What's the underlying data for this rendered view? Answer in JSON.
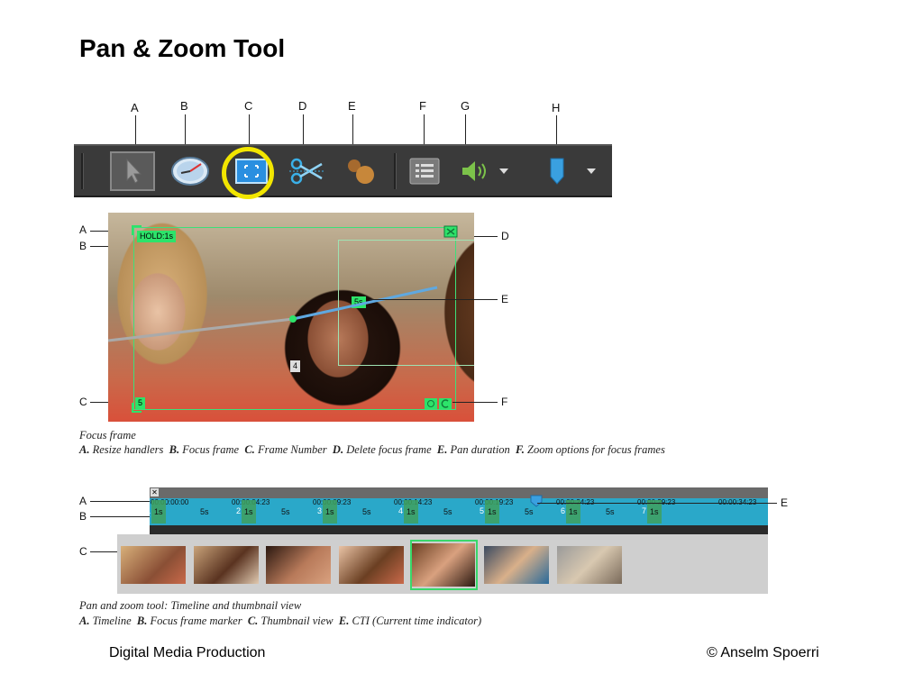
{
  "title": "Pan & Zoom Tool",
  "toolbar": {
    "callouts": [
      "A",
      "B",
      "C",
      "D",
      "E",
      "F",
      "G",
      "H"
    ],
    "buttons": [
      {
        "name": "selection-tool",
        "icon": "cursor-arrow-icon",
        "color": "#9a9a9a"
      },
      {
        "name": "time-stretch-tool",
        "icon": "clock-icon",
        "color": "#cfe3f3"
      },
      {
        "name": "pan-zoom-tool",
        "icon": "pan-zoom-frame-icon",
        "color": "#2a8fe0"
      },
      {
        "name": "scissors-tool",
        "icon": "scissors-icon",
        "color": "#3ab0e8"
      },
      {
        "name": "smart-trim-tool",
        "icon": "balloon-icon",
        "color": "#c7873a"
      },
      {
        "name": "properties-tool",
        "icon": "list-icon",
        "color": "#9a9a9a"
      },
      {
        "name": "audio-tool",
        "icon": "speaker-icon",
        "color": "#7cc24a"
      },
      {
        "name": "marker-tool",
        "icon": "marker-icon",
        "color": "#3aa0e0"
      }
    ],
    "highlight_color": "#f2e600"
  },
  "focus_frame": {
    "callouts_left": [
      "A",
      "B",
      "C"
    ],
    "callouts_right": [
      "D",
      "E",
      "F"
    ],
    "hold_tag": "HOLD:1s",
    "pan_duration_tag": "5s",
    "frame_number": "5",
    "secondary_frame_number": "4",
    "frame_color": "#3de07a",
    "caption_title": "Focus frame",
    "caption_items": [
      {
        "key": "A.",
        "text": "Resize handlers"
      },
      {
        "key": "B.",
        "text": "Focus frame"
      },
      {
        "key": "C.",
        "text": "Frame Number"
      },
      {
        "key": "D.",
        "text": "Delete focus frame"
      },
      {
        "key": "E.",
        "text": "Pan duration"
      },
      {
        "key": "F.",
        "text": "Zoom options for focus frames"
      }
    ]
  },
  "timeline": {
    "callouts_left": [
      "A",
      "B",
      "C"
    ],
    "callout_right": "E",
    "timecodes": [
      "00:00:00:00",
      "00:00:04:23",
      "00:00:09:23",
      "00:00:14:23",
      "00:00:19:23",
      "00:00:24:23",
      "00:00:29:23",
      "00:00:34:23"
    ],
    "frame_numbers": [
      "1",
      "2",
      "3",
      "4",
      "5",
      "6",
      "7"
    ],
    "hold_labels": [
      "1s",
      "1s",
      "1s",
      "1s",
      "1s",
      "1s",
      "1s"
    ],
    "pan_labels": [
      "5s",
      "5s",
      "5s",
      "5s",
      "5s",
      "5s"
    ],
    "ruler_color": "#2aa8c9",
    "caption_title": "Pan and zoom tool: Timeline and thumbnail view",
    "caption_items": [
      {
        "key": "A.",
        "text": "Timeline"
      },
      {
        "key": "B.",
        "text": "Focus frame marker"
      },
      {
        "key": "C.",
        "text": "Thumbnail view"
      },
      {
        "key": "E.",
        "text": "CTI (Current time indicator)"
      }
    ]
  },
  "footer": {
    "left": "Digital Media Production",
    "right": "© Anselm Spoerri"
  }
}
